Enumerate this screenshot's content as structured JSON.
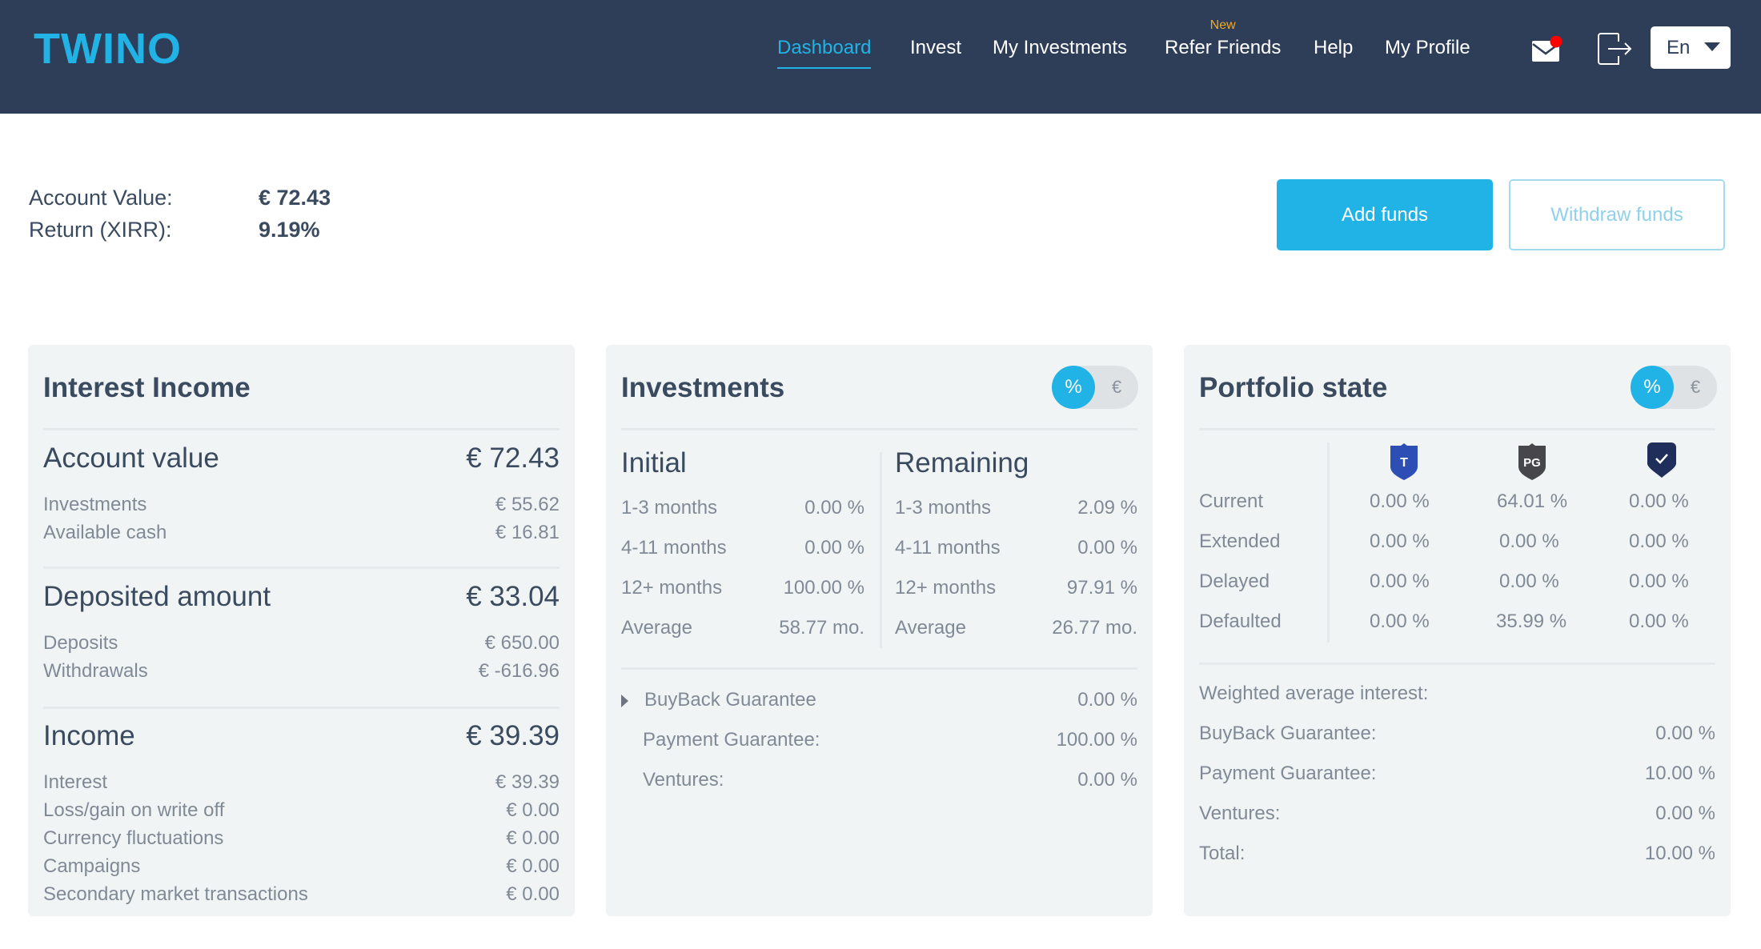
{
  "header": {
    "logo": "TWINO",
    "nav": [
      {
        "label": "Dashboard",
        "active": true
      },
      {
        "label": "Invest"
      },
      {
        "label": "My Investments"
      },
      {
        "label": "Refer Friends",
        "badge": "New"
      },
      {
        "label": "Help"
      },
      {
        "label": "My Profile"
      }
    ],
    "icons": {
      "mail": "envelope-icon",
      "mail_notification": true,
      "logout": "logout-icon"
    },
    "language": "En"
  },
  "summary": {
    "account_value_label": "Account Value:",
    "account_value": "€ 72.43",
    "return_label": "Return (XIRR):",
    "return_value": "9.19%"
  },
  "actions": {
    "add_funds": "Add funds",
    "withdraw_funds": "Withdraw funds"
  },
  "colors": {
    "header_bg": "#2e3e58",
    "accent": "#21b3e6",
    "badge_new": "#f4a81c",
    "panel_bg": "#f1f4f5"
  },
  "interest_income": {
    "title": "Interest Income",
    "sections": [
      {
        "label": "Account value",
        "value": "€ 72.43",
        "rows": [
          {
            "label": "Investments",
            "value": "€ 55.62"
          },
          {
            "label": "Available cash",
            "value": "€ 16.81"
          }
        ]
      },
      {
        "label": "Deposited amount",
        "value": "€ 33.04",
        "rows": [
          {
            "label": "Deposits",
            "value": "€ 650.00"
          },
          {
            "label": "Withdrawals",
            "value": "€ -616.96"
          }
        ]
      },
      {
        "label": "Income",
        "value": "€ 39.39",
        "rows": [
          {
            "label": "Interest",
            "value": "€ 39.39"
          },
          {
            "label": "Loss/gain on write off",
            "value": "€ 0.00"
          },
          {
            "label": "Currency fluctuations",
            "value": "€ 0.00"
          },
          {
            "label": "Campaigns",
            "value": "€ 0.00"
          },
          {
            "label": "Secondary market transactions",
            "value": "€ 0.00"
          }
        ]
      }
    ]
  },
  "investments": {
    "title": "Investments",
    "toggle": {
      "selected": "%",
      "other": "€"
    },
    "initial": {
      "heading": "Initial",
      "rows": [
        {
          "label": "1-3 months",
          "value": "0.00 %"
        },
        {
          "label": "4-11 months",
          "value": "0.00 %"
        },
        {
          "label": "12+ months",
          "value": "100.00 %"
        },
        {
          "label": "Average",
          "value": "58.77 mo."
        }
      ]
    },
    "remaining": {
      "heading": "Remaining",
      "rows": [
        {
          "label": "1-3 months",
          "value": "2.09 %"
        },
        {
          "label": "4-11 months",
          "value": "0.00 %"
        },
        {
          "label": "12+ months",
          "value": "97.91 %"
        },
        {
          "label": "Average",
          "value": "26.77 mo."
        }
      ]
    },
    "guarantees": [
      {
        "label": "BuyBack Guarantee",
        "value": "0.00 %",
        "expandable": true
      },
      {
        "label": "Payment Guarantee:",
        "value": "100.00 %"
      },
      {
        "label": "Ventures:",
        "value": "0.00 %"
      }
    ]
  },
  "portfolio_state": {
    "title": "Portfolio state",
    "toggle": {
      "selected": "%",
      "other": "€"
    },
    "columns": [
      {
        "icon": "buyback-shield-icon",
        "text": "T",
        "color": "#2d4fb5"
      },
      {
        "icon": "payment-guarantee-shield-icon",
        "text": "PG",
        "color": "#46464b"
      },
      {
        "icon": "ventures-check-icon",
        "text": "",
        "color": "#1f2e5a"
      }
    ],
    "rows": [
      {
        "label": "Current",
        "values": [
          "0.00 %",
          "64.01 %",
          "0.00 %"
        ]
      },
      {
        "label": "Extended",
        "values": [
          "0.00 %",
          "0.00 %",
          "0.00 %"
        ]
      },
      {
        "label": "Delayed",
        "values": [
          "0.00 %",
          "0.00 %",
          "0.00 %"
        ]
      },
      {
        "label": "Defaulted",
        "values": [
          "0.00 %",
          "35.99 %",
          "0.00 %"
        ]
      }
    ],
    "weighted_title": "Weighted average interest:",
    "weighted": [
      {
        "label": "BuyBack Guarantee:",
        "value": "0.00 %"
      },
      {
        "label": "Payment Guarantee:",
        "value": "10.00 %"
      },
      {
        "label": "Ventures:",
        "value": "0.00 %"
      },
      {
        "label": "Total:",
        "value": "10.00 %"
      }
    ]
  }
}
